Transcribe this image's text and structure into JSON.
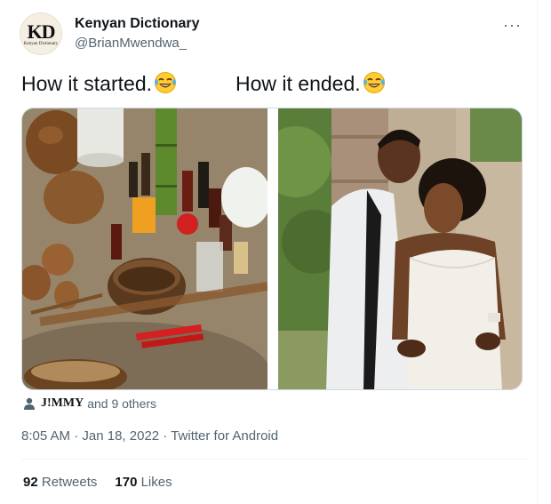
{
  "account": {
    "display_name": "Kenyan Dictionary",
    "handle": "@BrianMwendwa_",
    "avatar_text": "KD",
    "avatar_subtext": "Kenyan Dictionary"
  },
  "more_icon": "more-horizontal-icon",
  "tweet": {
    "caption_left": "How it started.",
    "caption_right": "How it ended.",
    "emoji": "face-with-tears-of-joy-emoji"
  },
  "media": {
    "left_photo": "ritual-items-photo",
    "right_photo": "wedding-couple-photo"
  },
  "likers": {
    "name": "J!MMY",
    "rest": "and 9 others"
  },
  "meta": {
    "time": "8:05 AM",
    "date": "Jan 18, 2022",
    "source": "Twitter for Android",
    "separator": "·"
  },
  "stats": {
    "retweets_count": "92",
    "retweets_label": "Retweets",
    "likes_count": "170",
    "likes_label": "Likes"
  },
  "colors": {
    "text": "#0f1419",
    "secondary": "#536471",
    "border": "#cfd9de"
  }
}
